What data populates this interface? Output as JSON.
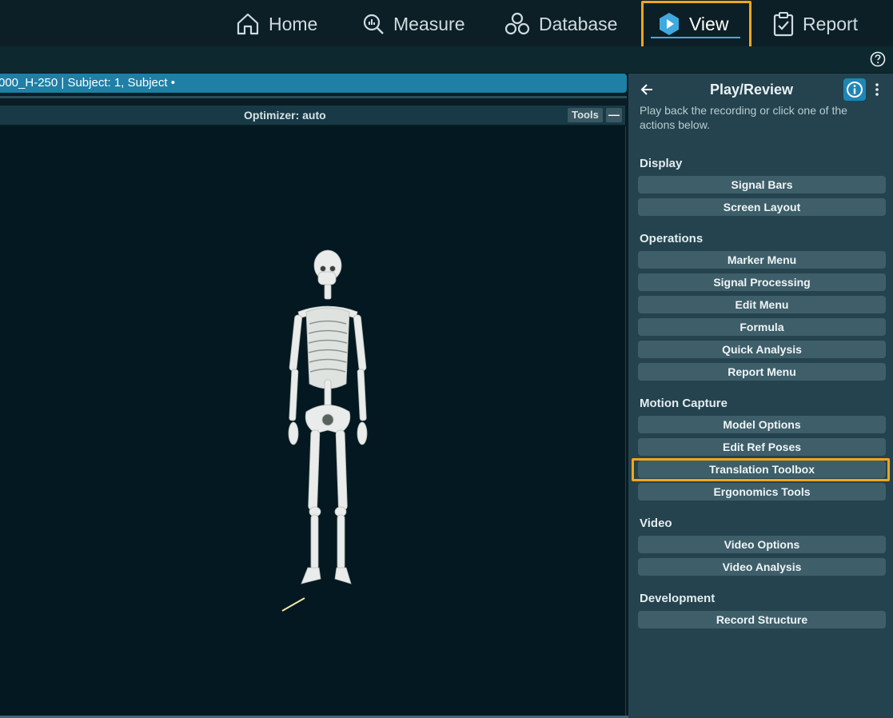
{
  "nav": {
    "home": "Home",
    "measure": "Measure",
    "database": "Database",
    "view": "View",
    "report": "Report"
  },
  "file_bar": {
    "text": "000_H-250 | Subject: 1, Subject •"
  },
  "viewport": {
    "title": "Optimizer: auto",
    "tools_label": "Tools",
    "minimize_label": "—"
  },
  "panel": {
    "title": "Play/Review",
    "description": "Play back the recording or click one of the actions below.",
    "sections": {
      "display": {
        "label": "Display",
        "buttons": [
          "Signal Bars",
          "Screen Layout"
        ]
      },
      "operations": {
        "label": "Operations",
        "buttons": [
          "Marker Menu",
          "Signal Processing",
          "Edit Menu",
          "Formula",
          "Quick Analysis",
          "Report Menu"
        ]
      },
      "motion": {
        "label": "Motion Capture",
        "buttons": [
          "Model Options",
          "Edit Ref Poses",
          "Translation Toolbox",
          "Ergonomics Tools"
        ]
      },
      "video": {
        "label": "Video",
        "buttons": [
          "Video Options",
          "Video Analysis"
        ]
      },
      "development": {
        "label": "Development",
        "buttons": [
          "Record Structure"
        ]
      }
    }
  },
  "icons": {
    "home": "home-icon",
    "measure": "measure-icon",
    "database": "database-icon",
    "view": "play-hexagon-icon",
    "report": "clipboard-check-icon",
    "help": "help-icon",
    "back": "back-arrow-icon",
    "info": "info-icon",
    "more": "kebab-icon"
  },
  "colors": {
    "accent": "#1f7fa6",
    "highlight": "#f2a51f",
    "panel": "#24434e",
    "button": "#3e5e69"
  }
}
